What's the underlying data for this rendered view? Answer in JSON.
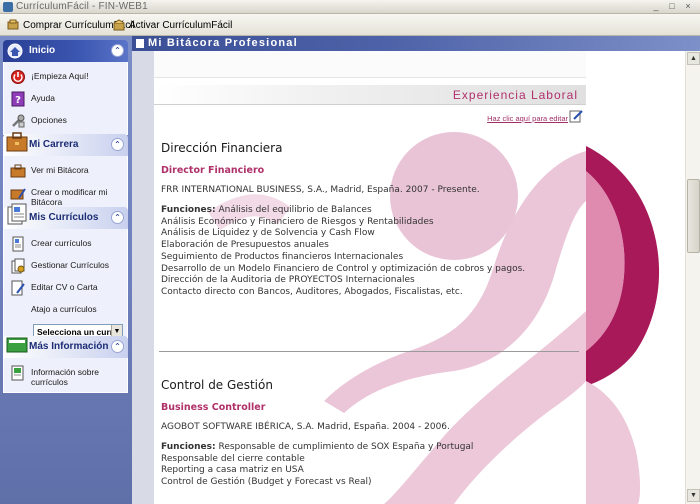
{
  "window": {
    "title": "CurrículumFácil - FIN-WEB1",
    "controls": [
      "_",
      "□",
      "×"
    ]
  },
  "toolbar": {
    "buy_label": "Comprar CurrículumFácil",
    "activate_label": "Activar CurrículumFácil"
  },
  "sidebar": {
    "inicio": {
      "title": "Inicio",
      "items": [
        "¡Empieza Aquí!",
        "Ayuda",
        "Opciones"
      ]
    },
    "carrera": {
      "title": "Mi Carrera",
      "items": [
        "Ver mi Bitácora",
        "Crear o modificar mi Bitácora"
      ]
    },
    "curriculos": {
      "title": "Mis Currículos",
      "items": [
        "Crear currículos",
        "Gestionar Currículos",
        "Editar CV o Carta",
        "Atajo a currículos"
      ],
      "select_value": "Selecciona un curri"
    },
    "info": {
      "title": "Más Información",
      "items": [
        "Información sobre currículos"
      ]
    }
  },
  "main": {
    "header_title": "Mi Bitácora Profesional",
    "section_title": "Experiencia Laboral",
    "edit_link": "Haz clic aquí para editar",
    "jobs": [
      {
        "area": "Dirección Financiera",
        "role": "Director Financiero",
        "company": "FRR INTERNATIONAL BUSINESS, S.A., Madrid, España. 2007 - Presente.",
        "functions_label": "Funciones:",
        "functions": [
          "Análisis del equilibrio de Balances",
          "Análisis Económico y Financiero de Riesgos y Rentabilidades",
          "Análisis de Liquidez y de Solvencia y Cash Flow",
          "Elaboración de Presupuestos anuales",
          "Seguimiento de Productos financieros Internacionales",
          "Desarrollo de un Modelo Financiero de Control y optimización de cobros y pagos.",
          "Dirección de la Auditoria de PROYECTOS Internacionales",
          "Contacto directo con Bancos, Auditores, Abogados, Fiscalistas, etc."
        ]
      },
      {
        "area": "Control de Gestión",
        "role": "Business Controller",
        "company": "AGOBOT SOFTWARE IBÉRICA, S.A. Madrid, España. 2004 - 2006.",
        "functions_label": "Funciones:",
        "functions": [
          "Responsable de cumplimiento de SOX España y Portugal",
          "Responsable del cierre contable",
          "Reporting a casa matriz en USA",
          "Control de Gestión (Budget y Forecast vs Real)"
        ]
      }
    ]
  },
  "colors": {
    "accent": "#b0306a",
    "sidebar_bg": "#6e80bd",
    "header_bg": "#3b4f96"
  },
  "icons": {
    "start": "power-icon",
    "help": "help-icon",
    "options": "tools-icon",
    "career": "briefcase-icon",
    "cv": "document-icon",
    "info": "book-icon",
    "edit": "pencil-icon"
  }
}
